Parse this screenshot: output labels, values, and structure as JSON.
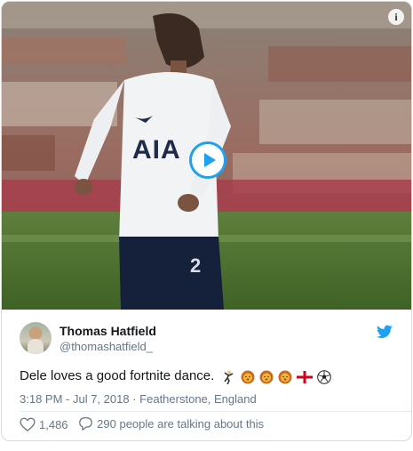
{
  "media": {
    "type": "video",
    "play_icon": "play-icon",
    "info_icon": "info-icon",
    "jersey_sponsor": "AIA",
    "shorts_number": "2"
  },
  "tweet": {
    "author_name": "Thomas Hatfield",
    "author_handle": "@thomashatfield_",
    "text": "Dele loves a good fortnite dance.",
    "emojis": [
      "dancing-man",
      "lion-face",
      "lion-face",
      "lion-face",
      "england-flag",
      "soccer-ball"
    ],
    "timestamp": "3:18 PM - Jul 7, 2018",
    "separator": "·",
    "location": "Featherstone, England",
    "likes": "1,486",
    "talking": "290 people are talking about this"
  },
  "colors": {
    "accent": "#1da1f2",
    "text": "#14171a",
    "secondary": "#657786",
    "border": "#d6dce0"
  }
}
